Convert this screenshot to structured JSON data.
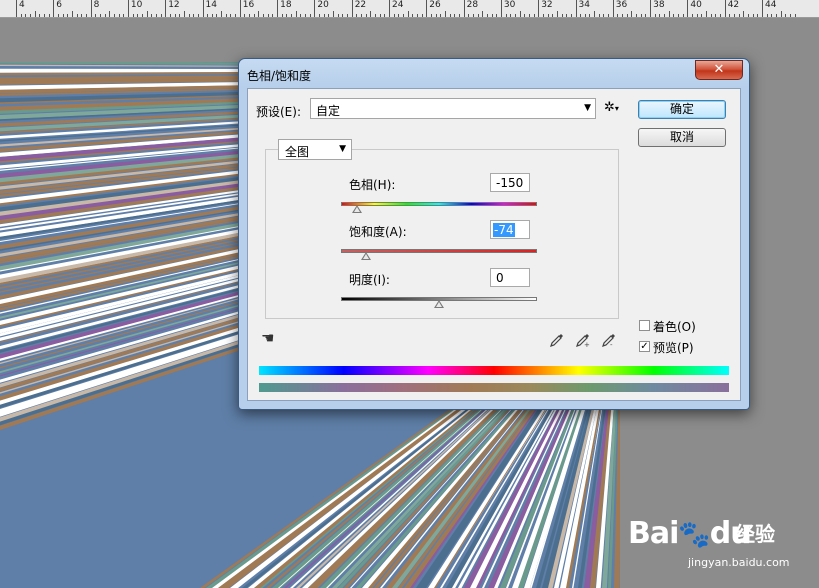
{
  "ruler": {
    "numbers": [
      "4",
      "6",
      "8",
      "10",
      "12",
      "14",
      "16",
      "18",
      "20",
      "22",
      "24",
      "26",
      "28",
      "30",
      "32",
      "34",
      "36",
      "38",
      "40",
      "42",
      "44"
    ]
  },
  "dialog": {
    "title": "色相/饱和度",
    "close_label": "✕",
    "preset_label": "预设(E):",
    "preset_value": "自定",
    "gear_icon": "✲",
    "ok_label": "确定",
    "cancel_label": "取消",
    "channel_value": "全图",
    "hue": {
      "label": "色相(H):",
      "value": "-150",
      "level": 0.083
    },
    "saturation": {
      "label": "饱和度(A):",
      "value": "-74",
      "level": 0.13
    },
    "lightness": {
      "label": "明度(I):",
      "value": "0",
      "level": 0.5
    },
    "colorize_label": "着色(O)",
    "colorize_checked": false,
    "preview_label": "预览(P)",
    "preview_checked": true,
    "check_mark": "✓"
  },
  "colors": {
    "accent": "#3399ff",
    "title_gradient_top": "#c6dbf2",
    "close_red": "#c0351a"
  },
  "watermark": {
    "brand": "Bai",
    "brand2": "du",
    "jingyan": "经验",
    "url": "jingyan.baidu.com"
  }
}
